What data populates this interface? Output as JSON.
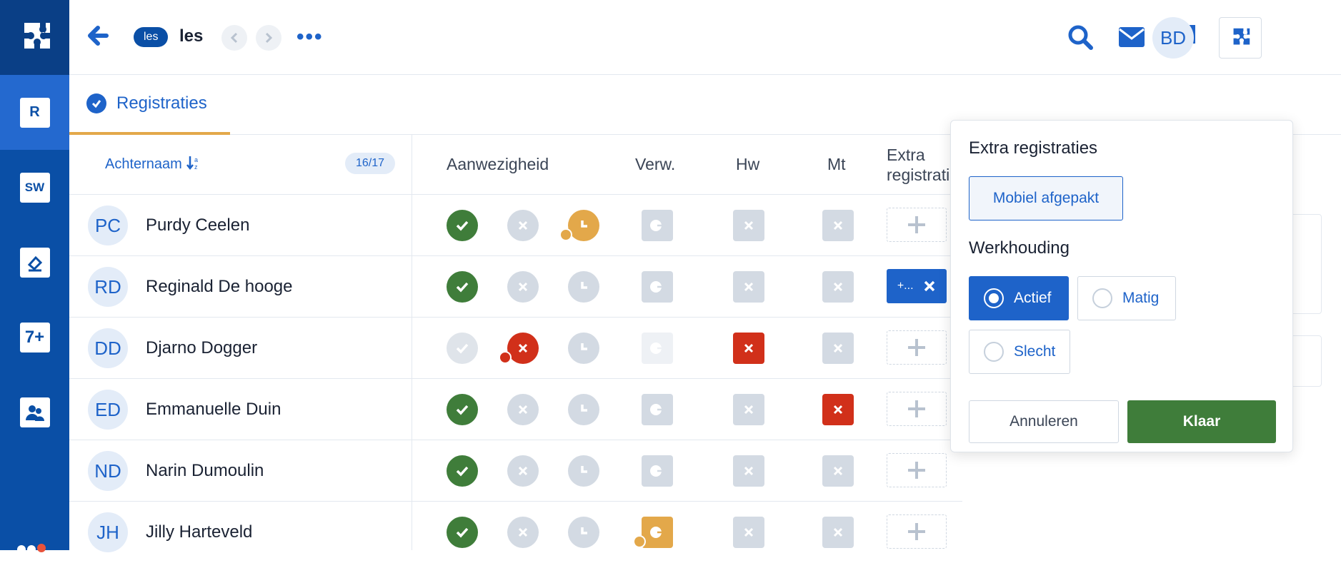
{
  "sidebar": {
    "items": [
      {
        "label": "R",
        "icon": "registratie-icon",
        "active": true
      },
      {
        "label": "SW",
        "icon": "sw-icon"
      },
      {
        "label": "",
        "icon": "eraser-icon"
      },
      {
        "label": "7+",
        "icon": "seven-plus-icon"
      },
      {
        "label": "",
        "icon": "people-icon"
      }
    ]
  },
  "header": {
    "chip": "les",
    "title": "les",
    "more": "•••",
    "avatar": "BD"
  },
  "tab": {
    "label": "Registraties"
  },
  "table": {
    "sort_label": "Achternaam",
    "count": "16/17",
    "columns": {
      "aanwezigheid": "Aanwezigheid",
      "verw": "Verw.",
      "hw": "Hw",
      "mt": "Mt",
      "extra_line1": "Extra",
      "extra_line2": "registraties"
    },
    "rows": [
      {
        "initials": "PC",
        "name": "Purdy Ceelen",
        "extra_label": ""
      },
      {
        "initials": "RD",
        "name": "Reginald De hooge",
        "extra_label": "+..."
      },
      {
        "initials": "DD",
        "name": "Djarno Dogger",
        "extra_label": ""
      },
      {
        "initials": "ED",
        "name": "Emmanuelle Duin",
        "extra_label": ""
      },
      {
        "initials": "ND",
        "name": "Narin Dumoulin",
        "extra_label": ""
      },
      {
        "initials": "JH",
        "name": "Jilly Harteveld",
        "extra_label": ""
      }
    ]
  },
  "popup": {
    "title": "Extra registraties",
    "extra_option": "Mobiel afgepakt",
    "werkhouding_title": "Werkhouding",
    "options": [
      "Actief",
      "Matig",
      "Slecht"
    ],
    "selected": "Actief",
    "cancel": "Annuleren",
    "done": "Klaar"
  },
  "colors": {
    "brand": "#0a4fa6",
    "accent": "#1e63c9",
    "present": "#3f7d3a",
    "absent": "#d1301a",
    "late": "#e3a84a",
    "neutral": "#d3dae3"
  }
}
